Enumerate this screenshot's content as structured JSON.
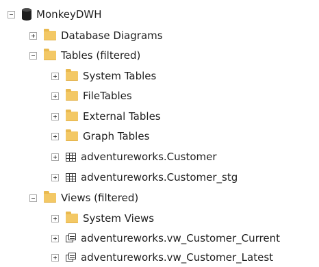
{
  "tree": {
    "root": {
      "label": "MonkeyDWH",
      "icon": "database-icon",
      "state": "expanded"
    },
    "items": [
      {
        "label": "Database Diagrams",
        "icon": "folder-icon",
        "state": "collapsed"
      },
      {
        "label": "Tables (filtered)",
        "icon": "folder-icon",
        "state": "expanded"
      },
      {
        "label": "System Tables",
        "icon": "folder-icon",
        "state": "collapsed"
      },
      {
        "label": "FileTables",
        "icon": "folder-icon",
        "state": "collapsed"
      },
      {
        "label": "External Tables",
        "icon": "folder-icon",
        "state": "collapsed"
      },
      {
        "label": "Graph Tables",
        "icon": "folder-icon",
        "state": "collapsed"
      },
      {
        "label": "adventureworks.Customer",
        "icon": "table-icon",
        "state": "collapsed"
      },
      {
        "label": "adventureworks.Customer_stg",
        "icon": "table-icon",
        "state": "collapsed"
      },
      {
        "label": "Views (filtered)",
        "icon": "folder-icon",
        "state": "expanded"
      },
      {
        "label": "System Views",
        "icon": "folder-icon",
        "state": "collapsed"
      },
      {
        "label": "adventureworks.vw_Customer_Current",
        "icon": "view-icon",
        "state": "collapsed"
      },
      {
        "label": "adventureworks.vw_Customer_Latest",
        "icon": "view-icon",
        "state": "collapsed"
      }
    ]
  },
  "colors": {
    "folder": "#f3c865",
    "text": "#1e1e1e",
    "background": "#ffffff"
  }
}
